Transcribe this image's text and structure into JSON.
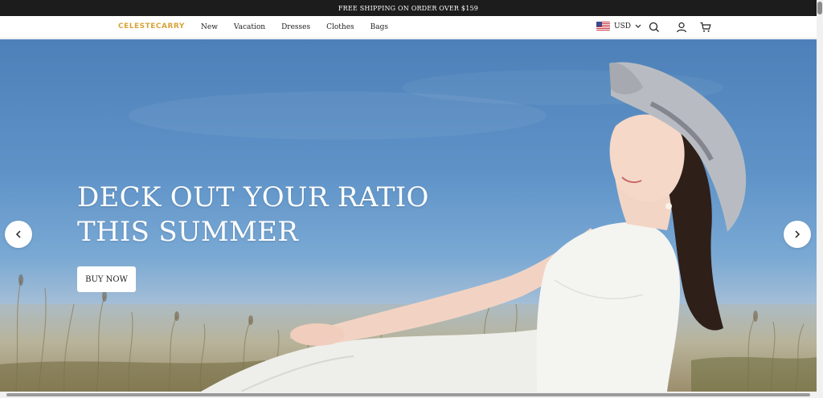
{
  "announcement": {
    "text": "FREE SHIPPING ON ORDER OVER $159"
  },
  "header": {
    "logo": "CELESTECARRY",
    "nav": [
      {
        "label": "New"
      },
      {
        "label": "Vacation"
      },
      {
        "label": "Dresses"
      },
      {
        "label": "Clothes"
      },
      {
        "label": "Bags"
      }
    ],
    "currency": "USD",
    "icons": [
      "us-flag-icon",
      "chevron-down-icon",
      "search-icon",
      "user-icon",
      "cart-icon"
    ]
  },
  "hero": {
    "title_line1": "DECK OUT YOUR RATIO",
    "title_line2": "THIS SUMMER",
    "button_label": "BUY NOW",
    "prev_icon": "chevron-left-icon",
    "next_icon": "chevron-right-icon"
  },
  "colors": {
    "announce_bg": "#1c1c1c",
    "logo": "#d8a43a",
    "sky": "#5f93c8"
  }
}
